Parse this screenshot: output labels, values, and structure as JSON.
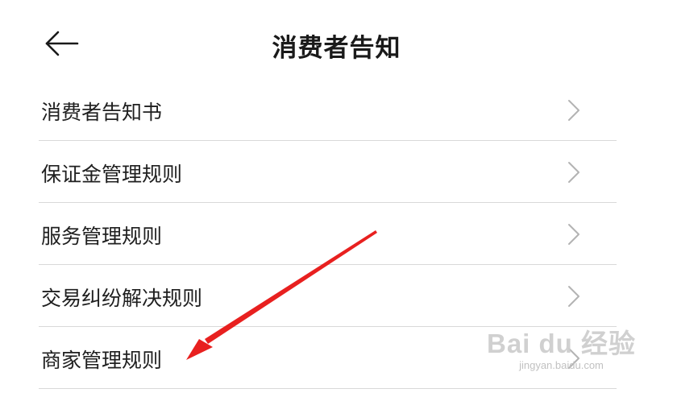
{
  "header": {
    "title": "消费者告知",
    "back_icon": "arrow-left-icon"
  },
  "list": {
    "items": [
      {
        "label": "消费者告知书",
        "icon": "chevron-right-icon"
      },
      {
        "label": "保证金管理规则",
        "icon": "chevron-right-icon"
      },
      {
        "label": "服务管理规则",
        "icon": "chevron-right-icon"
      },
      {
        "label": "交易纠纷解决规则",
        "icon": "chevron-right-icon"
      },
      {
        "label": "商家管理规则",
        "icon": "chevron-right-icon"
      }
    ]
  },
  "annotation": {
    "arrow_color": "#e8201f"
  },
  "watermark": {
    "brand": "Bai du 经验",
    "url": "jingyan.baidu.com"
  },
  "colors": {
    "divider": "#d9d9d9",
    "chevron": "#b3b3b3",
    "text": "#1f1f1f"
  }
}
